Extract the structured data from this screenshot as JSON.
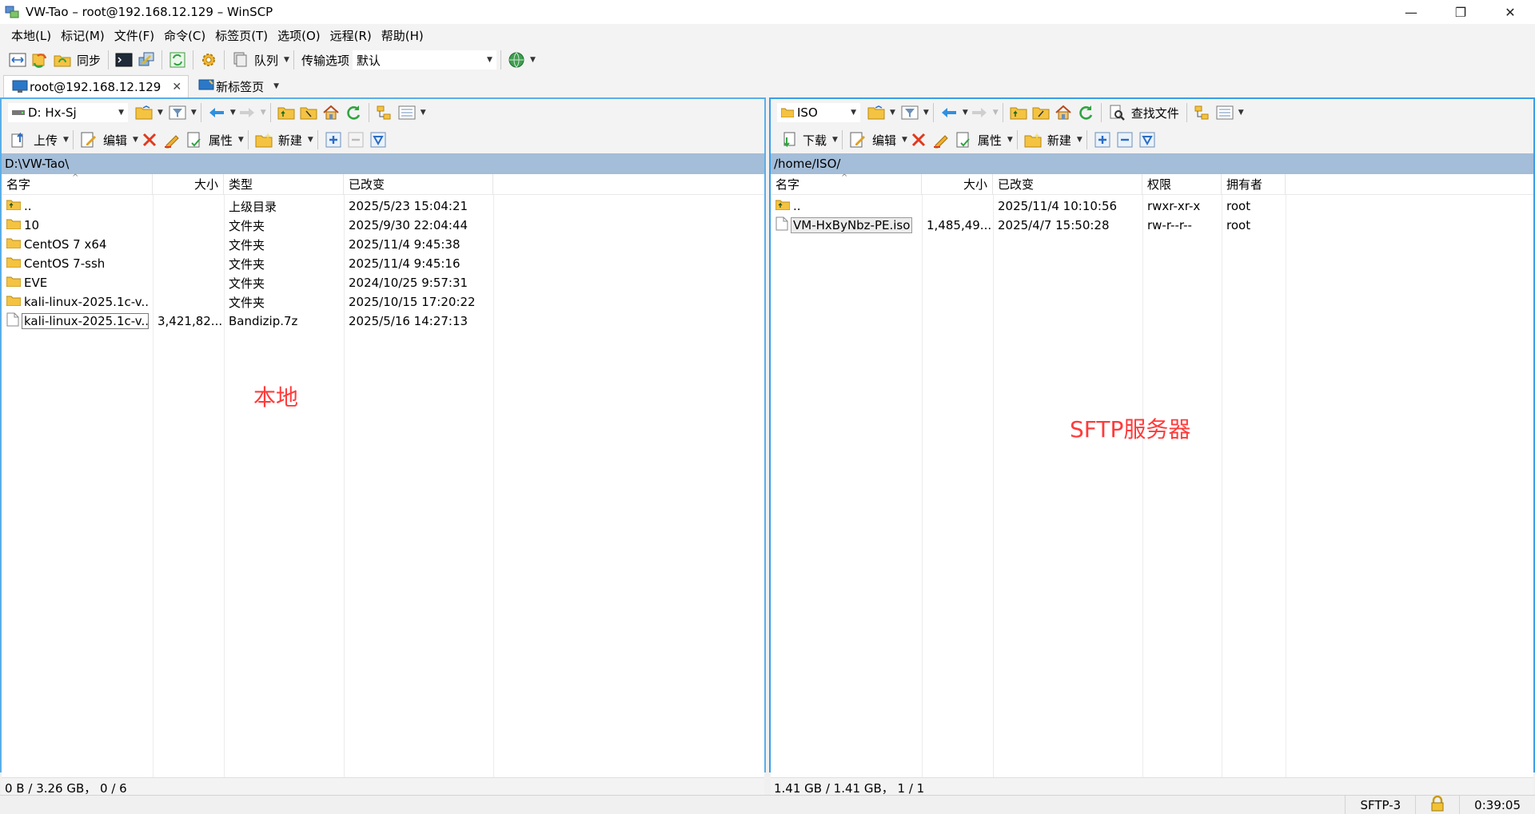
{
  "window": {
    "title": "VW-Tao – root@192.168.12.129 – WinSCP"
  },
  "menu": [
    "本地(L)",
    "标记(M)",
    "文件(F)",
    "命令(C)",
    "标签页(T)",
    "选项(O)",
    "远程(R)",
    "帮助(H)"
  ],
  "toolbar": {
    "sync_label": "同步",
    "queue_label": "队列",
    "transfer_options_label": "传输选项",
    "transfer_preset": "默认"
  },
  "tabs": [
    {
      "label": "root@192.168.12.129",
      "active": true
    },
    {
      "label": "新标签页",
      "active": false
    }
  ],
  "left": {
    "drive": "D: Hx-Sj",
    "upload_label": "上传",
    "edit_label": "编辑",
    "properties_label": "属性",
    "new_label": "新建",
    "path": "D:\\VW-Tao\\",
    "columns": [
      "名字",
      "大小",
      "类型",
      "已改变"
    ],
    "rows": [
      {
        "name": "..",
        "size": "",
        "type": "上级目录",
        "changed": "2025/5/23 15:04:21",
        "icon": "parent-folder"
      },
      {
        "name": "10",
        "size": "",
        "type": "文件夹",
        "changed": "2025/9/30 22:04:44",
        "icon": "folder"
      },
      {
        "name": "CentOS 7 x64",
        "size": "",
        "type": "文件夹",
        "changed": "2025/11/4 9:45:38",
        "icon": "folder"
      },
      {
        "name": "CentOS 7-ssh",
        "size": "",
        "type": "文件夹",
        "changed": "2025/11/4 9:45:16",
        "icon": "folder"
      },
      {
        "name": "EVE",
        "size": "",
        "type": "文件夹",
        "changed": "2024/10/25 9:57:31",
        "icon": "folder"
      },
      {
        "name": "kali-linux-2025.1c-v...",
        "size": "",
        "type": "文件夹",
        "changed": "2025/10/15 17:20:22",
        "icon": "folder"
      },
      {
        "name": "kali-linux-2025.1c-v...",
        "size": "3,421,82...",
        "type": "Bandizip.7z",
        "changed": "2025/5/16 14:27:13",
        "icon": "file"
      }
    ],
    "annotation": "本地",
    "status": "0 B / 3.26 GB， 0 / 6"
  },
  "right": {
    "drive": "ISO",
    "download_label": "下载",
    "edit_label": "编辑",
    "properties_label": "属性",
    "new_label": "新建",
    "find_label": "查找文件",
    "path": "/home/ISO/",
    "columns": [
      "名字",
      "大小",
      "已改变",
      "权限",
      "拥有者"
    ],
    "rows": [
      {
        "name": "..",
        "size": "",
        "changed": "2025/11/4 10:10:56",
        "perm": "rwxr-xr-x",
        "owner": "root",
        "icon": "parent-folder"
      },
      {
        "name": "VM-HxByNbz-PE.iso",
        "size": "1,485,49...",
        "changed": "2025/4/7 15:50:28",
        "perm": "rw-r--r--",
        "owner": "root",
        "icon": "file"
      }
    ],
    "annotation": "SFTP服务器",
    "status": "1.41 GB / 1.41 GB， 1 / 1"
  },
  "statusbar": {
    "protocol": "SFTP-3",
    "elapsed": "0:39:05"
  },
  "colors": {
    "accent": "#3a9ee8",
    "path_bar": "#a4bdd8",
    "annotation": "#ff3b3b",
    "folder": "#f5c342"
  }
}
